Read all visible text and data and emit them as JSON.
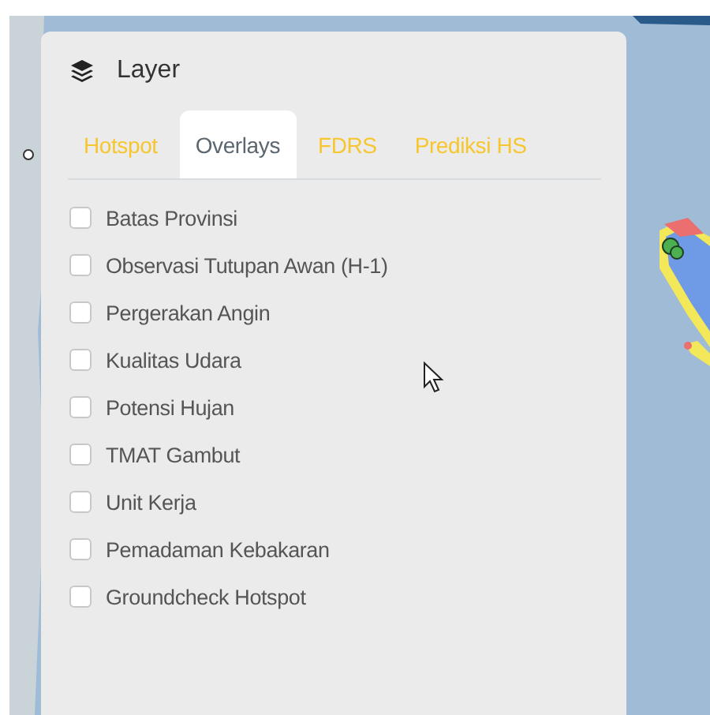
{
  "panel": {
    "title": "Layer",
    "tabs": [
      {
        "label": "Hotspot",
        "selected": false
      },
      {
        "label": "Overlays",
        "selected": true
      },
      {
        "label": "FDRS",
        "selected": false
      },
      {
        "label": "Prediksi HS",
        "selected": false
      }
    ],
    "overlays": [
      {
        "label": "Batas Provinsi",
        "checked": false
      },
      {
        "label": "Observasi Tutupan Awan (H-1)",
        "checked": false
      },
      {
        "label": "Pergerakan Angin",
        "checked": false
      },
      {
        "label": "Kualitas Udara",
        "checked": false
      },
      {
        "label": "Potensi Hujan",
        "checked": false
      },
      {
        "label": "TMAT Gambut",
        "checked": false
      },
      {
        "label": "Unit Kerja",
        "checked": false
      },
      {
        "label": "Pemadaman Kebakaran",
        "checked": false
      },
      {
        "label": "Groundcheck Hotspot",
        "checked": false
      }
    ]
  }
}
